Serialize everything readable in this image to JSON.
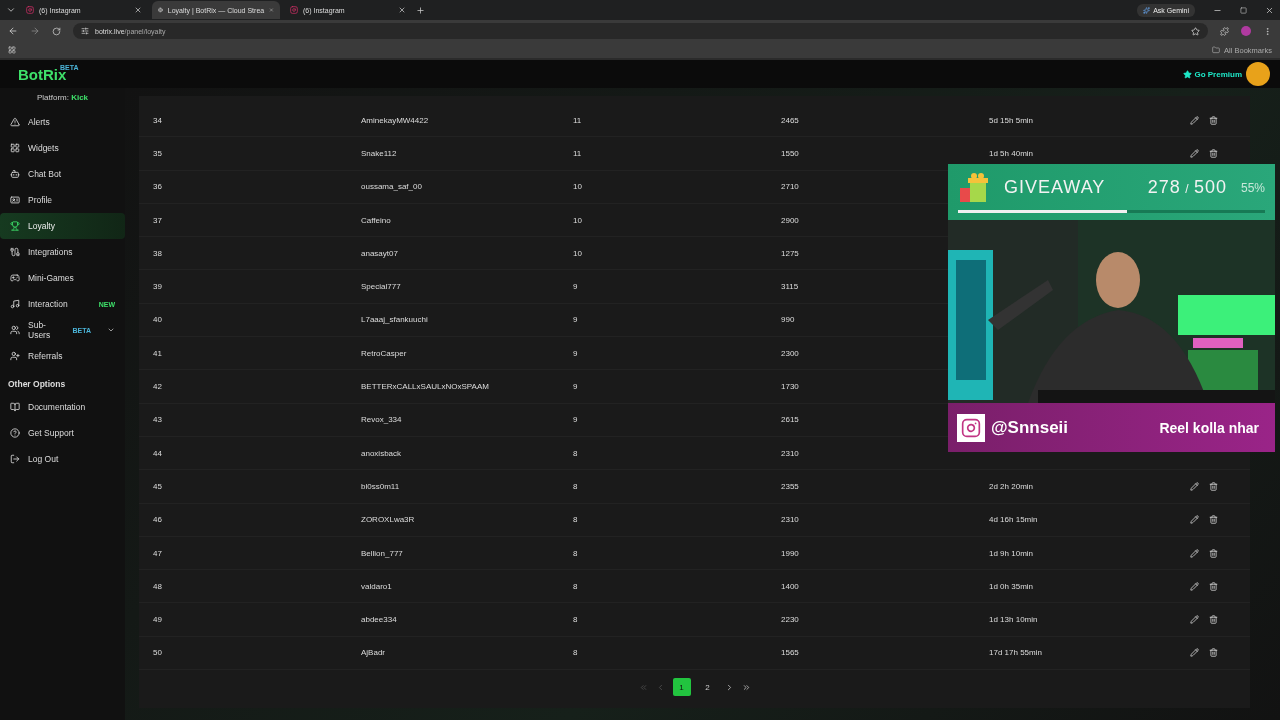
{
  "browser": {
    "tabs": [
      {
        "label": "(6) Instagram",
        "selected": false
      },
      {
        "label": "Loyalty | BotRix — Cloud Strea",
        "selected": true
      },
      {
        "label": "(6) Instagram",
        "selected": false
      }
    ],
    "ask": "Ask Gemini",
    "url_host": "botrix.live",
    "url_path": "/panel/loyalty",
    "bookmarks": "All Bookmarks"
  },
  "header": {
    "logo": "BotRix",
    "logo_badge": "BETA",
    "premium": "Go Premium"
  },
  "sidebar": {
    "platform_label": "Platform:",
    "platform": "Kick",
    "items": [
      {
        "label": "Alerts",
        "selected": false
      },
      {
        "label": "Widgets",
        "selected": false
      },
      {
        "label": "Chat Bot",
        "selected": false
      },
      {
        "label": "Profile",
        "selected": false
      },
      {
        "label": "Loyalty",
        "selected": true
      },
      {
        "label": "Integrations",
        "selected": false
      },
      {
        "label": "Mini-Games",
        "selected": false
      },
      {
        "label": "Interaction",
        "selected": false,
        "badge": "NEW"
      },
      {
        "label": "Sub-Users",
        "selected": false,
        "badge": "BETA",
        "expanded": false
      },
      {
        "label": "Referrals",
        "selected": false
      }
    ],
    "section": "Other Options",
    "other_items": [
      {
        "label": "Documentation",
        "selected": false
      },
      {
        "label": "Get Support",
        "selected": false
      },
      {
        "label": "Log Out",
        "selected": false
      }
    ]
  },
  "table": {
    "rows": [
      {
        "rank": "34",
        "name": "AminekayMW4422",
        "level": "11",
        "points": "2465",
        "time": "5d 15h 5min"
      },
      {
        "rank": "35",
        "name": "Snake112",
        "level": "11",
        "points": "1550",
        "time": "1d 5h 40min"
      },
      {
        "rank": "36",
        "name": "oussama_saf_00",
        "level": "10",
        "points": "2710"
      },
      {
        "rank": "37",
        "name": "Caffeino",
        "level": "10",
        "points": "2900"
      },
      {
        "rank": "38",
        "name": "anasayt07",
        "level": "10",
        "points": "1275"
      },
      {
        "rank": "39",
        "name": "Special777",
        "level": "9",
        "points": "3115"
      },
      {
        "rank": "40",
        "name": "L7aaaj_sfankuuchi",
        "level": "9",
        "points": "990"
      },
      {
        "rank": "41",
        "name": "RetroCasper",
        "level": "9",
        "points": "2300"
      },
      {
        "rank": "42",
        "name": "BETTERxCALLxSAULxNOxSPAAM",
        "level": "9",
        "points": "1730"
      },
      {
        "rank": "43",
        "name": "Revox_334",
        "level": "9",
        "points": "2615"
      },
      {
        "rank": "44",
        "name": "anoxisback",
        "level": "8",
        "points": "2310"
      },
      {
        "rank": "45",
        "name": "bl0ss0m11",
        "level": "8",
        "points": "2355",
        "time": "2d 2h 20min"
      },
      {
        "rank": "46",
        "name": "ZOROXLwa3R",
        "level": "8",
        "points": "2310",
        "time": "4d 16h 15min"
      },
      {
        "rank": "47",
        "name": "Bellion_777",
        "level": "8",
        "points": "1990",
        "time": "1d 9h 10min"
      },
      {
        "rank": "48",
        "name": "valdaro1",
        "level": "8",
        "points": "1400",
        "time": "1d 0h 35min"
      },
      {
        "rank": "49",
        "name": "abdee334",
        "level": "8",
        "points": "2230",
        "time": "1d 13h 10min"
      },
      {
        "rank": "50",
        "name": "AjBadr",
        "level": "8",
        "points": "1565",
        "time": "17d 17h 55min"
      }
    ]
  },
  "pagination": {
    "pages": [
      {
        "label": "1",
        "selected": true
      },
      {
        "label": "2",
        "selected": false
      }
    ]
  },
  "overlay": {
    "title": "GIVEAWAY",
    "count": "278",
    "sep": "/",
    "goal": "500",
    "percent": "55%",
    "level": 0.55,
    "handle": "@Snnseii",
    "message": "Reel kolla nhar"
  }
}
